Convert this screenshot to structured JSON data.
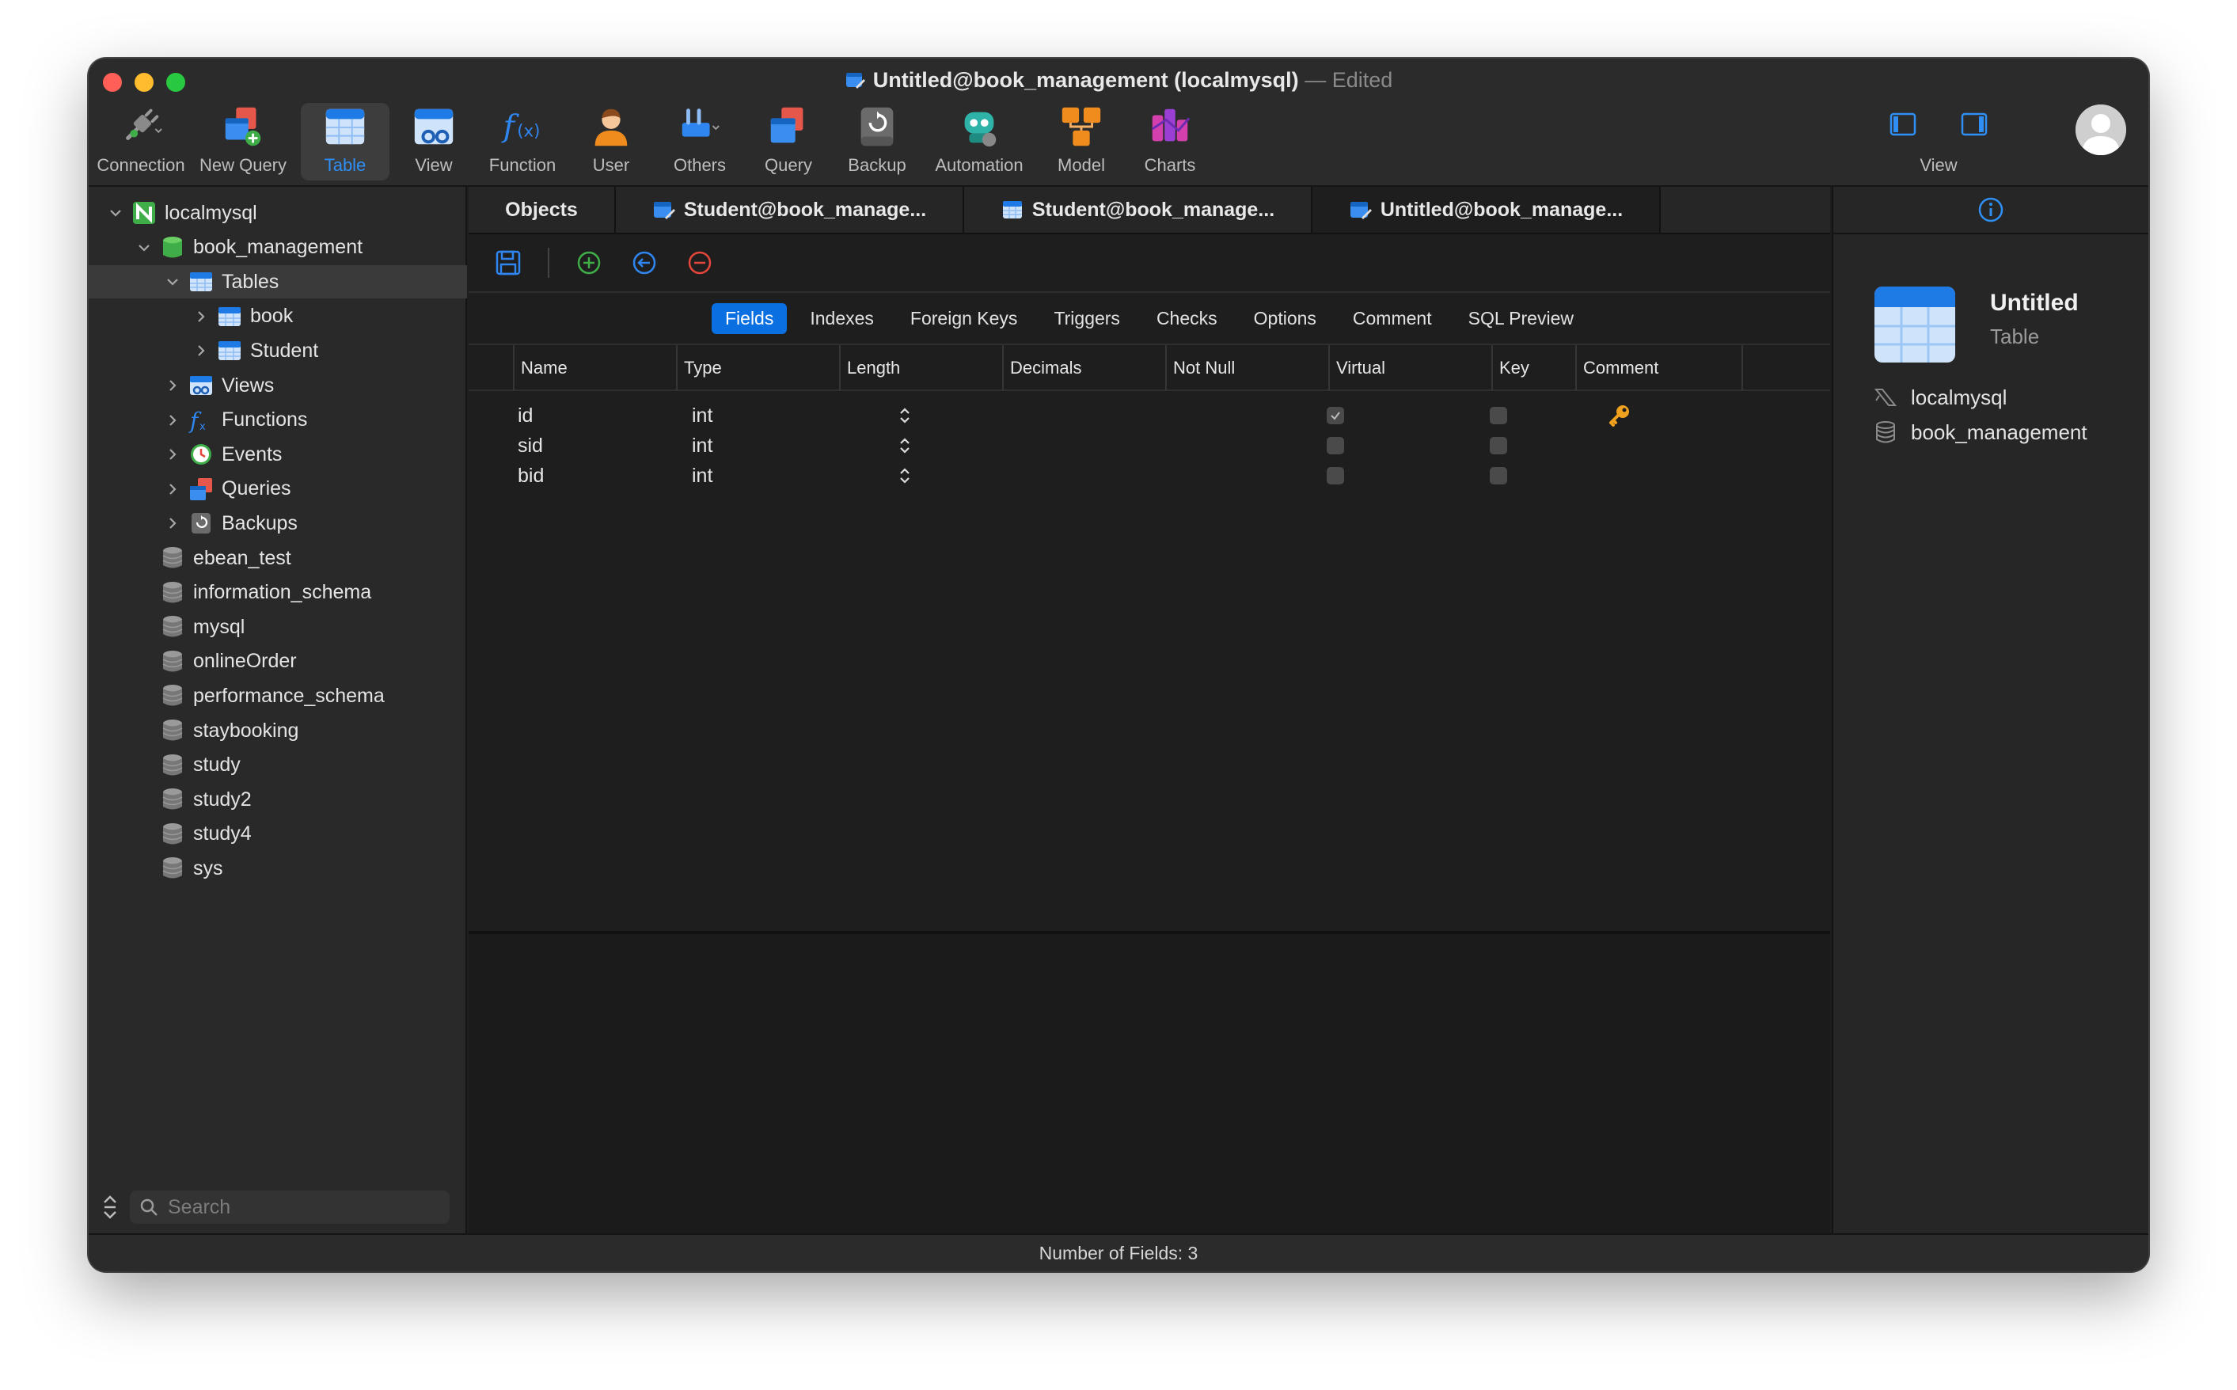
{
  "window": {
    "title": "Untitled@book_management (localmysql)",
    "edited": "— Edited"
  },
  "toolbar": {
    "items": [
      {
        "label": "Connection",
        "icon": "connection-icon"
      },
      {
        "label": "New Query",
        "icon": "new-query-icon"
      },
      {
        "label": "Table",
        "icon": "table-icon",
        "active": true
      },
      {
        "label": "View",
        "icon": "view-icon"
      },
      {
        "label": "Function",
        "icon": "function-icon"
      },
      {
        "label": "User",
        "icon": "user-icon"
      },
      {
        "label": "Others",
        "icon": "others-icon"
      },
      {
        "label": "Query",
        "icon": "query-icon"
      },
      {
        "label": "Backup",
        "icon": "backup-icon"
      },
      {
        "label": "Automation",
        "icon": "automation-icon"
      },
      {
        "label": "Model",
        "icon": "model-icon"
      },
      {
        "label": "Charts",
        "icon": "charts-icon"
      }
    ],
    "view_label": "View"
  },
  "sidebar": {
    "tree": [
      {
        "label": "localmysql",
        "level": 0,
        "expanded": true,
        "icon": "connection-green-icon"
      },
      {
        "label": "book_management",
        "level": 1,
        "expanded": true,
        "icon": "database-green-icon"
      },
      {
        "label": "Tables",
        "level": 2,
        "expanded": true,
        "icon": "tables-icon",
        "selected": true
      },
      {
        "label": "book",
        "level": 3,
        "expanded": false,
        "icon": "table-icon"
      },
      {
        "label": "Student",
        "level": 3,
        "expanded": false,
        "icon": "table-icon"
      },
      {
        "label": "Views",
        "level": 2,
        "expanded": false,
        "icon": "views-icon"
      },
      {
        "label": "Functions",
        "level": 2,
        "expanded": false,
        "icon": "functions-icon"
      },
      {
        "label": "Events",
        "level": 2,
        "expanded": false,
        "icon": "events-icon"
      },
      {
        "label": "Queries",
        "level": 2,
        "expanded": false,
        "icon": "queries-icon"
      },
      {
        "label": "Backups",
        "level": 2,
        "expanded": false,
        "icon": "backups-icon"
      },
      {
        "label": "ebean_test",
        "level": 1,
        "icon": "database-gray-icon"
      },
      {
        "label": "information_schema",
        "level": 1,
        "icon": "database-gray-icon"
      },
      {
        "label": "mysql",
        "level": 1,
        "icon": "database-gray-icon"
      },
      {
        "label": "onlineOrder",
        "level": 1,
        "icon": "database-gray-icon"
      },
      {
        "label": "performance_schema",
        "level": 1,
        "icon": "database-gray-icon"
      },
      {
        "label": "staybooking",
        "level": 1,
        "icon": "database-gray-icon"
      },
      {
        "label": "study",
        "level": 1,
        "icon": "database-gray-icon"
      },
      {
        "label": "study2",
        "level": 1,
        "icon": "database-gray-icon"
      },
      {
        "label": "study4",
        "level": 1,
        "icon": "database-gray-icon"
      },
      {
        "label": "sys",
        "level": 1,
        "icon": "database-gray-icon"
      }
    ],
    "search_placeholder": "Search"
  },
  "tabs": [
    {
      "label": "Objects"
    },
    {
      "label": "Student@book_manage..."
    },
    {
      "label": "Student@book_manage..."
    },
    {
      "label": "Untitled@book_manage...",
      "active": true
    }
  ],
  "segments": [
    "Fields",
    "Indexes",
    "Foreign Keys",
    "Triggers",
    "Checks",
    "Options",
    "Comment",
    "SQL Preview"
  ],
  "grid": {
    "columns": [
      "Name",
      "Type",
      "Length",
      "Decimals",
      "Not Null",
      "Virtual",
      "Key",
      "Comment"
    ],
    "rows": [
      {
        "name": "id",
        "type": "int",
        "not_null": true,
        "virtual": false,
        "key": true
      },
      {
        "name": "sid",
        "type": "int",
        "not_null": false,
        "virtual": false,
        "key": false
      },
      {
        "name": "bid",
        "type": "int",
        "not_null": false,
        "virtual": false,
        "key": false
      }
    ]
  },
  "info_panel": {
    "title": "Untitled",
    "subtitle": "Table",
    "connection": "localmysql",
    "database": "book_management"
  },
  "status": {
    "text": "Number of Fields: 3"
  },
  "colors": {
    "accent": "#0a6fe0",
    "traffic_close": "#ff5f57",
    "traffic_min": "#febc2e",
    "traffic_max": "#28c840"
  }
}
